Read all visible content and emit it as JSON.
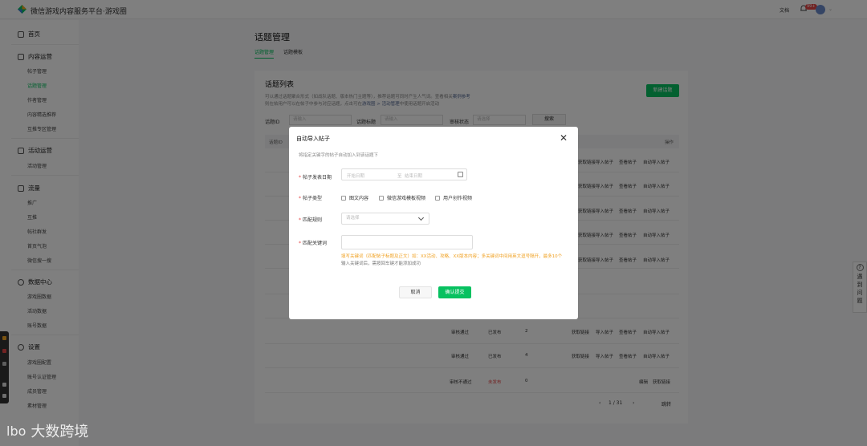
{
  "topbar": {
    "title": "微信游戏内容服务平台·游戏圈",
    "doc_link": "文档",
    "bell_badge": "99+"
  },
  "sidebar": {
    "home": "首页",
    "content_ops": "内容运营",
    "content_items": [
      "帖子管理",
      "话题管理",
      "作者管理",
      "内容精选推荐",
      "互推专区管理"
    ],
    "activity_ops": "活动运营",
    "activity_items": [
      "活动管理"
    ],
    "traffic": "流量",
    "traffic_items": [
      "推广",
      "互推",
      "帖社群发",
      "首页气泡",
      "微信搜一搜"
    ],
    "data_center": "数据中心",
    "data_items": [
      "游戏圈数据",
      "活动数据",
      "账号数据"
    ],
    "settings": "设置",
    "settings_items": [
      "游戏圈配置",
      "账号认证管理",
      "成员管理",
      "素材管理"
    ]
  },
  "page": {
    "title": "话题管理",
    "tabs": [
      "话题管理",
      "话题模板"
    ]
  },
  "card": {
    "title": "话题列表",
    "desc_line1": "可以通过话题聚合形式（如战队话题、版本热门主题等），推荐话题可同时产生人气词。查看相关",
    "desc_link1": "案例参考",
    "desc_line2": "则在帖用户可以在帖子中参与对应话题，点击可在",
    "desc_link2": "游戏圈 > 活动管理",
    "desc_line3": "中使用话题开启活动",
    "new_button": "新建话题",
    "filter_id_label": "话题ID",
    "filter_id_placeholder": "请输入",
    "filter_name_label": "话题标题",
    "filter_name_placeholder": "请输入",
    "filter_status_label": "审核状态",
    "filter_status_placeholder": "请选择",
    "search_button": "搜索",
    "th_id": "话题ID",
    "th_ops": "操作"
  },
  "rows": [
    {
      "status": "审核通过",
      "state": "已发布",
      "count": "2",
      "actions": [
        "获取链接",
        "导入帖子",
        "查看帖子",
        "自动导入帖子"
      ]
    },
    {
      "status": "审核通过",
      "state": "已发布",
      "count": "4",
      "actions": [
        "获取链接",
        "导入帖子",
        "查看帖子",
        "自动导入帖子"
      ]
    },
    {
      "status": "审核不通过",
      "state": "未发布",
      "count": "0",
      "actions": [
        "编辑",
        "获取链接"
      ]
    }
  ],
  "bg_row_actions": [
    "获取链接",
    "导入帖子",
    "查看帖子",
    "自动导入帖子"
  ],
  "pager": {
    "text": "1 / 31",
    "goto": "跳转"
  },
  "feedback": {
    "chars": [
      "遇",
      "到",
      "问",
      "题"
    ]
  },
  "modal": {
    "title": "自动导入帖子",
    "desc": "将指定关键字的帖子自动加入到该话题下",
    "date_label": "帖子发表日期",
    "date_start": "开始日期",
    "date_sep": "至",
    "date_end": "结束日期",
    "type_label": "帖子类型",
    "type_options": [
      "图文内容",
      "微信游戏模板视频",
      "用户创作视频"
    ],
    "rule_label": "匹配规则",
    "rule_placeholder": "请选择",
    "keyword_label": "匹配关键词",
    "hint": "填写关键词（匹配帖子标题及正文）如：XX活动、攻略、XX版本内容；多关键词中间用英文逗号隔开，最多10个",
    "hint2": "输入关键词后，需按回车键才能添加成功",
    "cancel": "取消",
    "confirm": "确认提交"
  },
  "watermark": {
    "mark": "lbo",
    "text": "大数跨境"
  },
  "colors": {
    "accent": "#07c160",
    "danger": "#e54545",
    "warning": "#f0a020"
  }
}
